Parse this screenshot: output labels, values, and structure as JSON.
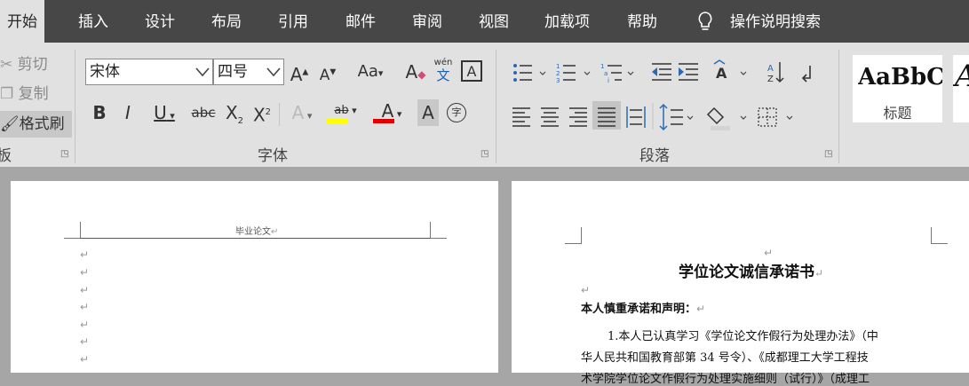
{
  "tabs": [
    {
      "label": "开始",
      "active": true
    },
    {
      "label": "插入"
    },
    {
      "label": "设计"
    },
    {
      "label": "布局"
    },
    {
      "label": "引用"
    },
    {
      "label": "邮件"
    },
    {
      "label": "审阅"
    },
    {
      "label": "视图"
    },
    {
      "label": "加载项"
    },
    {
      "label": "帮助"
    }
  ],
  "tell_me": "操作说明搜索",
  "clipboard": {
    "cut": "剪切",
    "copy": "复制",
    "format_painter": "格式刷",
    "group_label_partial": "板"
  },
  "font": {
    "name": "宋体",
    "size": "四号",
    "group_label": "字体",
    "change_case": "Aa",
    "phonetic_top": "wén",
    "phonetic_bottom": "文",
    "char_border": "A",
    "bold": "B",
    "italic": "I",
    "underline": "U",
    "strike": "abc",
    "subscript": "X",
    "sub_mark": "2",
    "superscript": "X",
    "sup_mark": "2",
    "text_effect": "A",
    "highlight": "ab",
    "font_color": "A",
    "char_shading": "A",
    "enclose": "字"
  },
  "paragraph": {
    "group_label": "段落"
  },
  "styles": {
    "preview": "AaBbC",
    "name": "标题",
    "preview2": "A"
  },
  "colors": {
    "highlight": "#ffff00",
    "font_color": "#e00000",
    "tabbar": "#474747",
    "ribbon": "#e1e1e1"
  },
  "doc_left": {
    "header_text": "毕业论文",
    "para_marks": [
      "↵",
      "↵",
      "↵",
      "↵",
      "↵",
      "↵",
      "↵"
    ]
  },
  "doc_right": {
    "top_mark": "↵",
    "title": "学位论文诚信承诺书",
    "mark_after_title": "↵",
    "blank_mark": "↵",
    "heading": "本人慎重承诺和声明：",
    "mark_after_heading": "↵",
    "body_line1": "1.本人已认真学习《学位论文作假行为处理办法》（中",
    "body_line2": "华人民共和国教育部第 34 号令）、《成都理工大学工程技",
    "body_line3": "术学院学位论文作假行为处理实施细则（试行）》（成理工"
  }
}
